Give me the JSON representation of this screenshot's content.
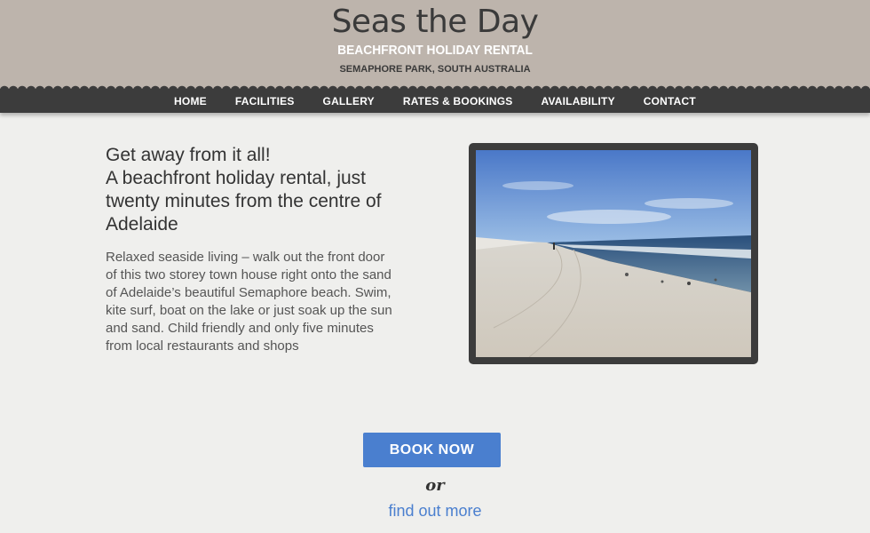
{
  "header": {
    "title": "Seas the Day",
    "tagline": "BEACHFRONT HOLIDAY RENTAL",
    "location": "SEMAPHORE PARK, SOUTH AUSTRALIA"
  },
  "nav": {
    "items": [
      "HOME",
      "FACILITIES",
      "GALLERY",
      "RATES & BOOKINGS",
      "AVAILABILITY",
      "CONTACT"
    ]
  },
  "intro": {
    "heading_line1": "Get away from it all!",
    "heading_line2": "A beachfront holiday rental, just twenty minutes from the centre of Adelaide",
    "body": "Relaxed seaside living – walk out the front door of this two storey town house right onto the sand of Adelaide’s beautiful Semaphore beach. Swim, kite surf, boat on the lake or just soak up the sun and sand. Child friendly and only five minutes from local restaurants and shops"
  },
  "cta": {
    "book_label": "BOOK NOW",
    "or_label": "or",
    "find_out_label": "find out more"
  },
  "colors": {
    "header_bg": "#bdb4ac",
    "nav_bg": "#3c3c3c",
    "accent": "#4a7fcf",
    "page_bg": "#efefed"
  }
}
